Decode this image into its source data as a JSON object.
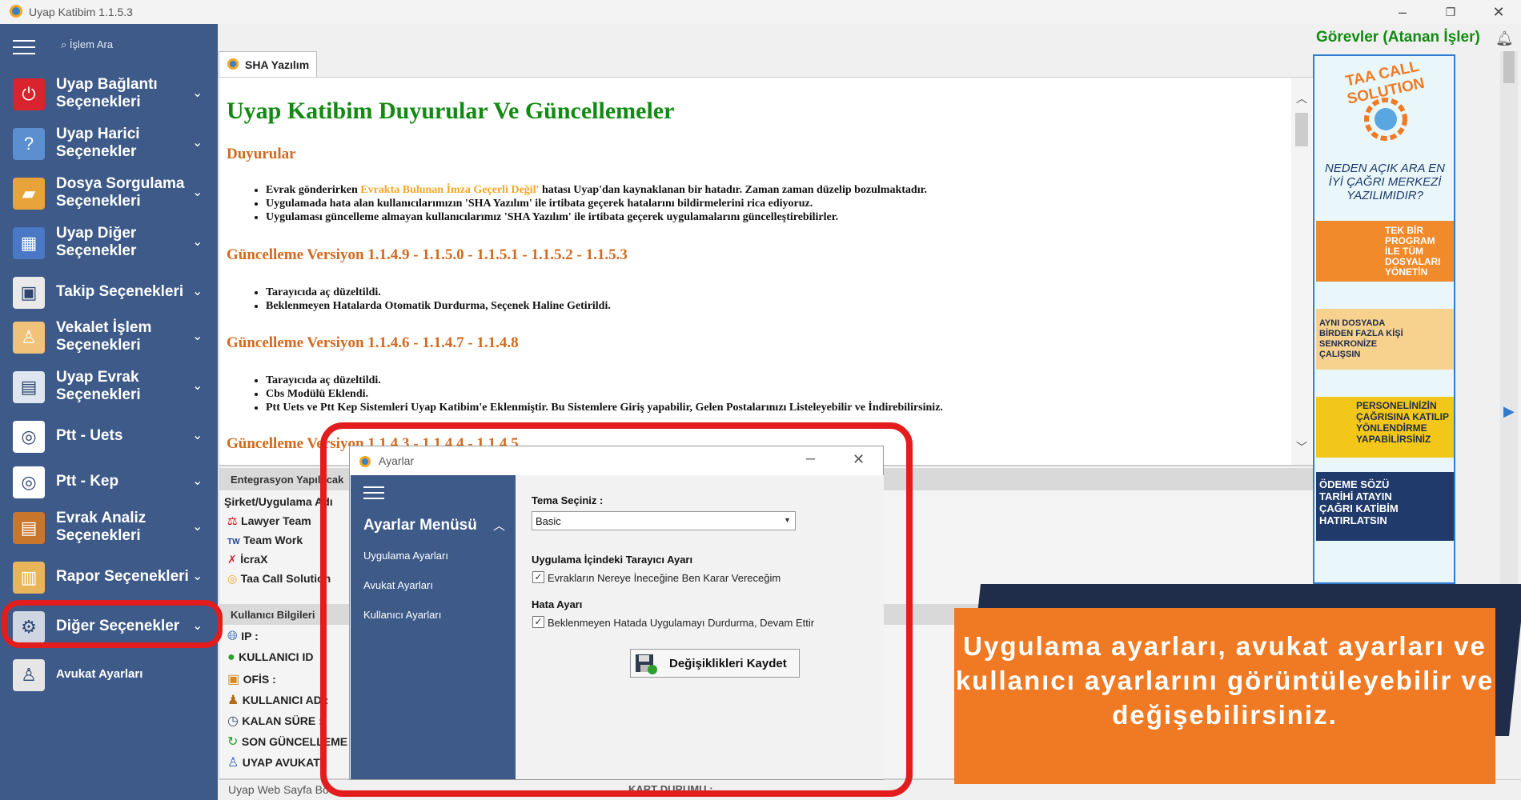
{
  "window": {
    "title": "Uyap Katibim 1.1.5.3"
  },
  "sidebar": {
    "search_label": "İşlem Ara",
    "items": [
      {
        "label": "Uyap Bağlantı Seçenekleri",
        "icon": "uyap-icon"
      },
      {
        "label": "Uyap Harici Seçenekler",
        "icon": "help-icon"
      },
      {
        "label": "Dosya Sorgulama Seçenekleri",
        "icon": "folder-icon"
      },
      {
        "label": "Uyap Diğer Seçenekler",
        "icon": "grid-icon"
      },
      {
        "label": "Takip Seçenekleri",
        "icon": "frame-icon"
      },
      {
        "label": "Vekalet İşlem Seçenekleri",
        "icon": "lawyer-icon"
      },
      {
        "label": "Uyap Evrak Seçenekleri",
        "icon": "document-icon"
      },
      {
        "label": "Ptt - Uets",
        "icon": "ptt-icon"
      },
      {
        "label": "Ptt - Kep",
        "icon": "ptt-icon"
      },
      {
        "label": "Evrak Analiz Seçenekleri",
        "icon": "briefcase-icon"
      },
      {
        "label": "Rapor Seçenekleri",
        "icon": "clipboard-icon"
      },
      {
        "label": "Diğer Seçenekler",
        "icon": "gear-icon"
      },
      {
        "label": "Avukat Ayarları",
        "icon": "user-icon"
      }
    ]
  },
  "tab": {
    "label": "SHA Yazılım"
  },
  "announcements": {
    "title": "Uyap Katibim Duyurular Ve Güncellemeler",
    "duyurular_heading": "Duyurular",
    "duyurular": {
      "b1_pre": "Evrak gönderirken ",
      "b1_highlight": "Evrakta Bulunan İmza Geçerli Değil'",
      "b1_post": " hatası Uyap'dan kaynaklanan bir hatadır. Zaman zaman düzelip bozulmaktadır.",
      "b2": "Uygulamada hata alan kullanıcılarımızın 'SHA Yazılım' ile irtibata geçerek hatalarını bildirmelerini rica ediyoruz.",
      "b3": "Uygulaması güncelleme almayan kullanıcılarımız 'SHA Yazılım' ile irtibata geçerek uygulamalarını güncelleştirebilirler."
    },
    "update1_heading": "Güncelleme Versiyon 1.1.4.9 - 1.1.5.0 - 1.1.5.1 - 1.1.5.2 - 1.1.5.3",
    "update1": [
      "Tarayıcıda aç düzeltildi.",
      "Beklenmeyen Hatalarda Otomatik Durdurma, Seçenek Haline Getirildi."
    ],
    "update2_heading": "Güncelleme Versiyon 1.1.4.6 - 1.1.4.7 - 1.1.4.8",
    "update2": [
      "Tarayıcıda aç düzeltildi.",
      "Cbs Modülü Eklendi.",
      "Ptt Uets ve Ptt Kep Sistemleri Uyap Katibim'e Eklenmiştir. Bu Sistemlere Giriş yapabilir, Gelen Postalarınızı Listeleyebilir ve İndirebilirsiniz."
    ],
    "update3_heading": "Güncelleme Versiyon 1.1.4.3 - 1.1.4.4 - 1.1.4.5"
  },
  "integration": {
    "heading": "Entegrasyon Yapılacak",
    "column": "Şirket/Uygulama Adı",
    "rows": [
      "Lawyer Team",
      "Team Work",
      "İcraX",
      "Taa Call Solution"
    ]
  },
  "user_info": {
    "heading": "Kullanıcı Bilgileri",
    "rows": [
      "IP :",
      "KULLANICI ID",
      "OFİS :",
      "KULLANICI AD :",
      "KALAN SÜRE :",
      "SON GÜNCELLEME :",
      "UYAP AVUKAT"
    ]
  },
  "status": {
    "web": "Uyap Web Sayfa Bo",
    "kart": "KART DURUMU :"
  },
  "right": {
    "tasks_title": "Görevler (Atanan İşler)",
    "ad": {
      "brand": "TAA CALL SOLUTION",
      "tagline": "NEDEN AÇIK ARA EN İYİ ÇAĞRI MERKEZİ YAZILIMIDIR?",
      "card1": "TEK BİR PROGRAM İLE TÜM DOSYALARI YÖNETİN",
      "card2": "AYNI DOSYADA BİRDEN FAZLA KİŞİ SENKRONİZE ÇALIŞSIN",
      "card3": "PERSONELİNİZİN ÇAĞRISINA KATILIP YÖNLENDİRME YAPABİLİRSİNİZ",
      "card4": "ÖDEME SÖZÜ TARİHİ ATAYIN ÇAĞRI KATİBİM HATIRLATSIN"
    }
  },
  "dialog": {
    "title": "Ayarlar",
    "menu_title": "Ayarlar Menüsü",
    "menu_items": [
      "Uygulama Ayarları",
      "Avukat Ayarları",
      "Kullanıcı Ayarları"
    ],
    "theme_label": "Tema Seçiniz :",
    "theme_value": "Basic",
    "browser_section": "Uygulama İçindeki Tarayıcı Ayarı",
    "browser_check": "Evrakların Nereye İneceğine Ben Karar Vereceğim",
    "error_section": "Hata Ayarı",
    "error_check": "Beklenmeyen Hatada Uygulamayı Durdurma, Devam Ettir",
    "save_button": "Değişiklikleri Kaydet"
  },
  "banner": {
    "text": "Uygulama ayarları, avukat ayarları ve kullanıcı ayarlarını görüntüleyebilir ve değişebilirsiniz."
  },
  "colors": {
    "sidebar": "#3d5a89",
    "accent_green": "#128a12",
    "heading_orange": "#d2691e",
    "annotation_red": "#e31d1d",
    "banner_orange": "#f07a24"
  }
}
